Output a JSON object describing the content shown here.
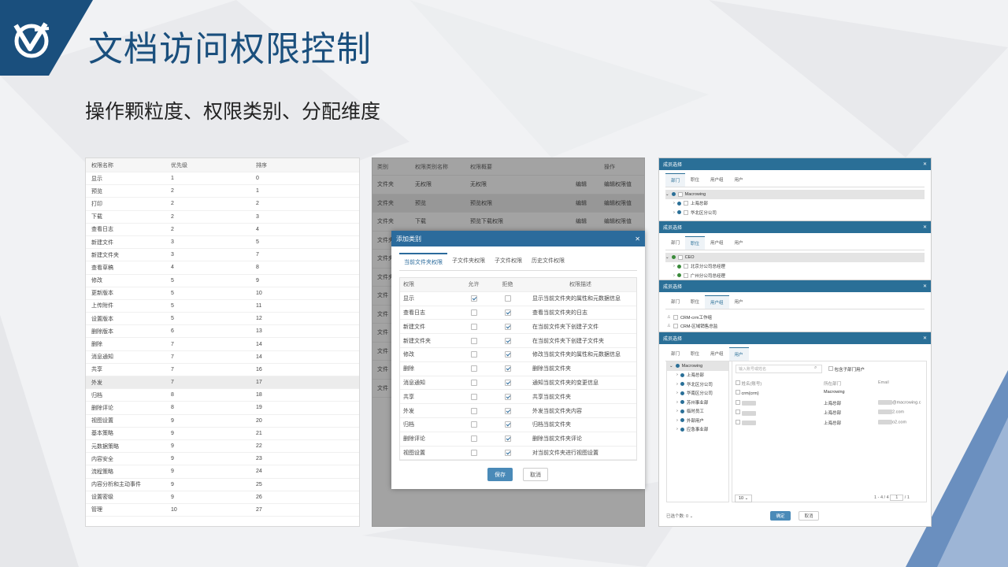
{
  "title": "文档访问权限控制",
  "subtitle": "操作颗粒度、权限类别、分配维度",
  "colors": {
    "brand": "#1a4f7d",
    "accent": "#2b6b9c"
  },
  "p1": {
    "headers": [
      "权限名称",
      "优先级",
      "排序"
    ],
    "rows": [
      [
        "显示",
        "1",
        "0"
      ],
      [
        "预览",
        "2",
        "1"
      ],
      [
        "打印",
        "2",
        "2"
      ],
      [
        "下载",
        "2",
        "3"
      ],
      [
        "查看日志",
        "2",
        "4"
      ],
      [
        "新建文件",
        "3",
        "5"
      ],
      [
        "新建文件夹",
        "3",
        "7"
      ],
      [
        "查看草稿",
        "4",
        "8"
      ],
      [
        "修改",
        "5",
        "9"
      ],
      [
        "更新版本",
        "5",
        "10"
      ],
      [
        "上传附件",
        "5",
        "11"
      ],
      [
        "设置版本",
        "5",
        "12"
      ],
      [
        "删除版本",
        "6",
        "13"
      ],
      [
        "删除",
        "7",
        "14"
      ],
      [
        "消息通知",
        "7",
        "14"
      ],
      [
        "共享",
        "7",
        "16"
      ],
      [
        "外发",
        "7",
        "17"
      ],
      [
        "归档",
        "8",
        "18"
      ],
      [
        "删除评论",
        "8",
        "19"
      ],
      [
        "视图设置",
        "9",
        "20"
      ],
      [
        "基本策略",
        "9",
        "21"
      ],
      [
        "元数据策略",
        "9",
        "22"
      ],
      [
        "内容安全",
        "9",
        "23"
      ],
      [
        "流程策略",
        "9",
        "24"
      ],
      [
        "内容分析和主动事件",
        "9",
        "25"
      ],
      [
        "设置密级",
        "9",
        "26"
      ],
      [
        "管理",
        "10",
        "27"
      ]
    ]
  },
  "p2": {
    "headers": [
      "类别",
      "权限类别名称",
      "权限概要",
      "",
      "操作"
    ],
    "rows": [
      [
        "文件夹",
        "无权限",
        "无权限",
        "编辑",
        "编辑权限值"
      ],
      [
        "文件夹",
        "预览",
        "预览权限",
        "编辑",
        "编辑权限值"
      ],
      [
        "文件夹",
        "下载",
        "预览下载权限",
        "编辑",
        "编辑权限值"
      ],
      [
        "文件夹",
        "",
        "",
        "",
        ""
      ],
      [
        "文件夹",
        "",
        "",
        "",
        ""
      ],
      [
        "文件夹",
        "",
        "",
        "",
        ""
      ],
      [
        "文件",
        "",
        "",
        "",
        ""
      ],
      [
        "文件",
        "",
        "",
        "",
        ""
      ],
      [
        "文件",
        "",
        "",
        "",
        ""
      ],
      [
        "文件",
        "",
        "",
        "",
        ""
      ],
      [
        "文件",
        "",
        "",
        "",
        ""
      ],
      [
        "文件",
        "",
        "",
        "",
        ""
      ]
    ],
    "dialog": {
      "title": "添加类别",
      "close": "✕",
      "tabs": [
        "当前文件夹权限",
        "子文件夹权限",
        "子文件权限",
        "历史文件权限"
      ],
      "headers": [
        "权限",
        "允许",
        "拒绝",
        "权限描述"
      ],
      "rows": [
        {
          "n": "显示",
          "a": true,
          "d": false,
          "t": "显示当前文件夹的属性和元数据信息"
        },
        {
          "n": "查看日志",
          "a": false,
          "d": true,
          "t": "查看当前文件夹的日志"
        },
        {
          "n": "新建文件",
          "a": false,
          "d": true,
          "t": "在当前文件夹下创建子文件"
        },
        {
          "n": "新建文件夹",
          "a": false,
          "d": true,
          "t": "在当前文件夹下创建子文件夹"
        },
        {
          "n": "修改",
          "a": false,
          "d": true,
          "t": "修改当前文件夹的属性和元数据信息"
        },
        {
          "n": "删除",
          "a": false,
          "d": true,
          "t": "删除当前文件夹"
        },
        {
          "n": "消息通知",
          "a": false,
          "d": true,
          "t": "通知当前文件夹的变更信息"
        },
        {
          "n": "共享",
          "a": false,
          "d": true,
          "t": "共享当前文件夹"
        },
        {
          "n": "外发",
          "a": false,
          "d": true,
          "t": "外发当前文件夹内容"
        },
        {
          "n": "归档",
          "a": false,
          "d": true,
          "t": "归档当前文件夹"
        },
        {
          "n": "删除评论",
          "a": false,
          "d": true,
          "t": "删除当前文件夹评论"
        },
        {
          "n": "视图设置",
          "a": false,
          "d": true,
          "t": "对当前文件夹进行视图设置"
        }
      ],
      "save": "保存",
      "cancel": "取消"
    }
  },
  "p3": {
    "title": "成员选择",
    "close": "✕",
    "tabs": [
      "部门",
      "职位",
      "用户组",
      "用户"
    ],
    "m1": {
      "root": "Macrowing",
      "children": [
        "上海总部",
        "华北区分公司"
      ]
    },
    "m2": {
      "root": "CEO",
      "children": [
        "北京分公司总经理",
        "广州分公司总经理"
      ]
    },
    "m3": {
      "items": [
        "CRM-crm工作组",
        "CRM-区域销售总监"
      ]
    },
    "m4": {
      "tree": [
        "Macrowing",
        "上海总部",
        "华北区分公司",
        "华南区分公司",
        "苏州事业部",
        "临时员工",
        "外部用户",
        "应急事业部"
      ],
      "search": "输入账号或姓名",
      "include": "包含子部门用户",
      "cols": [
        "姓名(账号)",
        "所在部门",
        "Email"
      ],
      "rows": [
        [
          "crm(crm)",
          "Macrowing",
          ""
        ],
        [
          "",
          "上海总部",
          "@macrowing.c"
        ],
        [
          "",
          "上海总部",
          "2.com"
        ],
        [
          "",
          "上海总部",
          "o2.com"
        ]
      ],
      "pagesize": "10",
      "pager": "1 - 4 / 4",
      "page": "1",
      "pages": "/ 1",
      "selected": "已选个数: 0",
      "ok": "确定",
      "cancel": "取消"
    }
  }
}
